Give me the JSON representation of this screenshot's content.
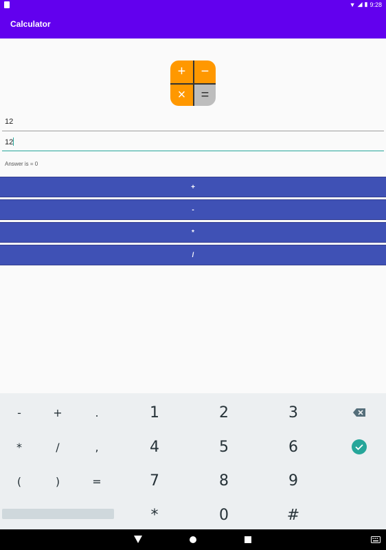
{
  "status": {
    "time": "9:28"
  },
  "app": {
    "title": "Calculator"
  },
  "logo": {
    "plus": "+",
    "minus": "−",
    "times": "×",
    "equals": "="
  },
  "inputs": {
    "first_value": "12",
    "second_value": "12"
  },
  "answer_text": "Answer is = 0",
  "buttons": {
    "add": "+",
    "subtract": "-",
    "multiply": "*",
    "divide": "/"
  },
  "keyboard": {
    "row1": [
      "-",
      "+",
      ".",
      "1",
      "2",
      "3"
    ],
    "row2": [
      "*",
      "/",
      ",",
      "4",
      "5",
      "6"
    ],
    "row3": [
      "(",
      ")",
      "=",
      "7",
      "8",
      "9"
    ],
    "row4": [
      "*",
      "0",
      "#"
    ]
  },
  "colors": {
    "primary": "#6200ee",
    "button": "#3f51b5",
    "accent": "#26a69a",
    "logo_orange": "#ff9800",
    "logo_gray": "#bdbdbd"
  }
}
